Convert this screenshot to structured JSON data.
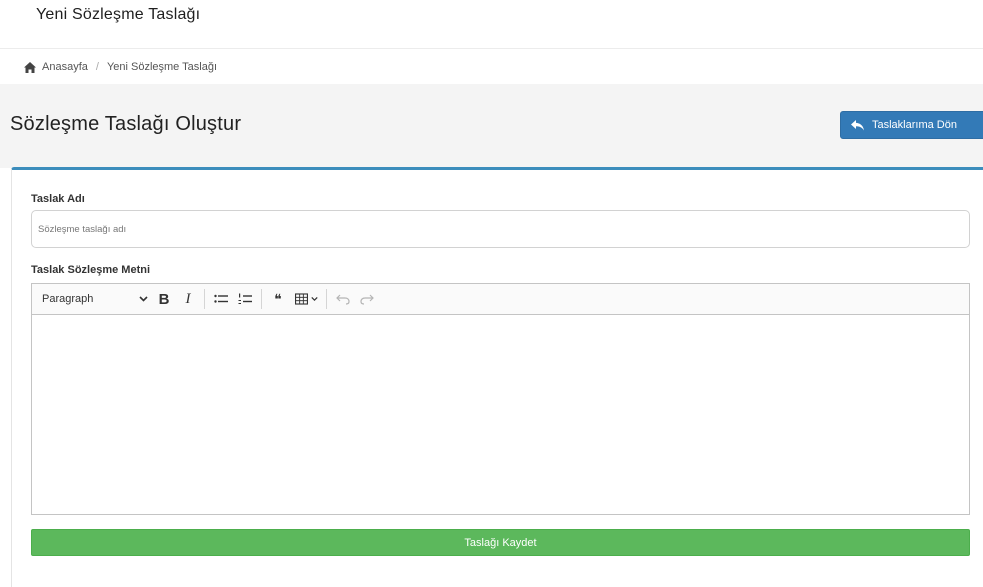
{
  "topbar": {
    "title": "Yeni Sözleşme Taslağı"
  },
  "breadcrumb": {
    "home_icon": "home-icon",
    "home_label": "Anasayfa",
    "separator": "/",
    "current": "Yeni Sözleşme Taslağı"
  },
  "header": {
    "title": "Sözleşme Taslağı Oluştur",
    "back_label": "Taslaklarıma Dön",
    "back_icon": "reply-icon"
  },
  "form": {
    "name_label": "Taslak Adı",
    "name_value": "",
    "name_placeholder": "Sözleşme taslağı adı",
    "text_label": "Taslak Sözleşme Metni",
    "editor": {
      "format_selected": "Paragraph",
      "buttons": [
        "bold-icon",
        "italic-icon",
        "bulleted-list-icon",
        "numbered-list-icon",
        "blockquote-icon",
        "table-icon",
        "undo-icon",
        "redo-icon"
      ],
      "bold_glyph": "B",
      "italic_glyph": "I",
      "quote_glyph": "❝",
      "content": ""
    },
    "save_label": "Taslağı Kaydet"
  },
  "colors": {
    "primary": "#337ab7",
    "success": "#5cb85c",
    "card_border": "#3c8dbc",
    "header_bg": "#f4f4f4"
  }
}
